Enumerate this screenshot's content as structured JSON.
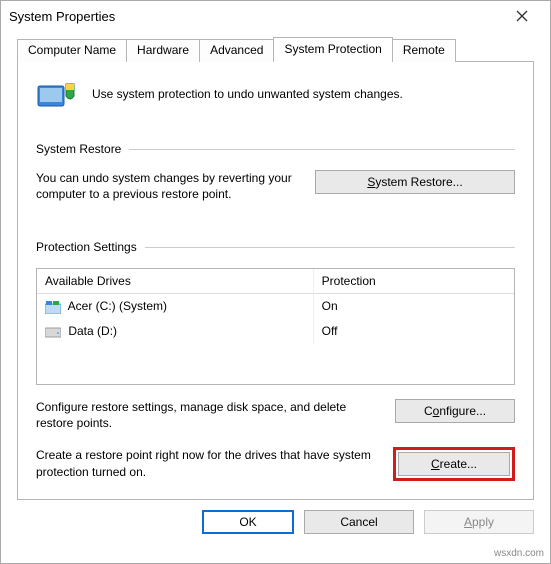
{
  "window": {
    "title": "System Properties",
    "close_tooltip": "Close"
  },
  "tabs": {
    "computer_name": "Computer Name",
    "hardware": "Hardware",
    "advanced": "Advanced",
    "system_protection": "System Protection",
    "remote": "Remote"
  },
  "intro": {
    "text": "Use system protection to undo unwanted system changes."
  },
  "restore_section": {
    "heading": "System Restore",
    "text": "You can undo system changes by reverting your computer to a previous restore point.",
    "button": "System Restore..."
  },
  "protection_section": {
    "heading": "Protection Settings",
    "col_drive": "Available Drives",
    "col_protection": "Protection",
    "drives": [
      {
        "name": "Acer (C:) (System)",
        "protection": "On",
        "icon": "windows"
      },
      {
        "name": "Data (D:)",
        "protection": "Off",
        "icon": "drive"
      }
    ],
    "configure_text": "Configure restore settings, manage disk space, and delete restore points.",
    "configure_button": "Configure...",
    "create_text": "Create a restore point right now for the drives that have system protection turned on.",
    "create_button": "Create..."
  },
  "dialog_buttons": {
    "ok": "OK",
    "cancel": "Cancel",
    "apply": "Apply"
  },
  "watermark": "wsxdn.com"
}
